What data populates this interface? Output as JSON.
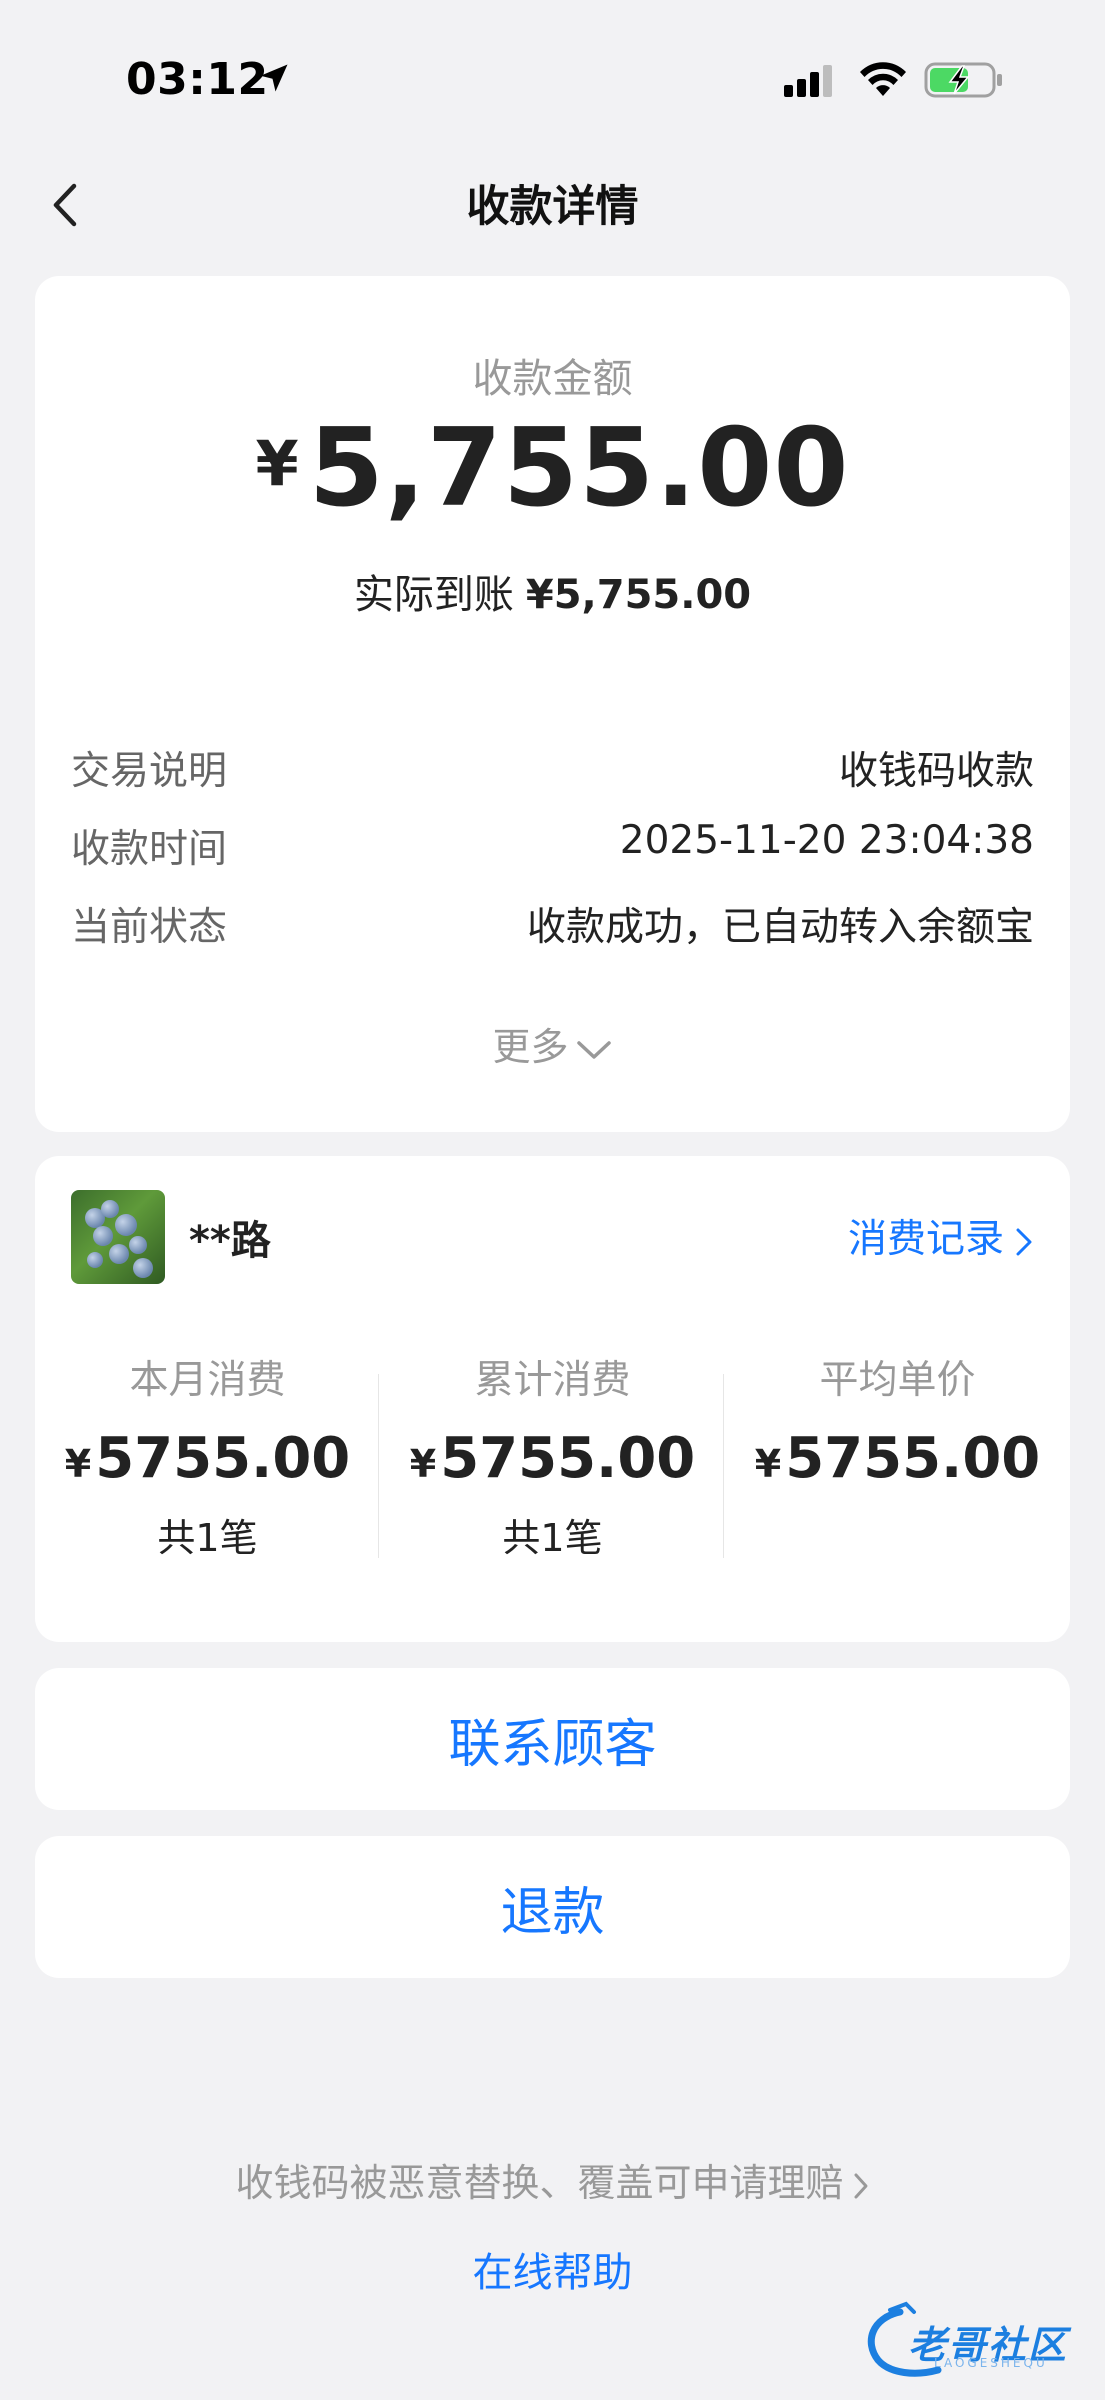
{
  "status_bar": {
    "time": "03:12"
  },
  "nav": {
    "title": "收款详情"
  },
  "summary": {
    "amount_label": "收款金额",
    "currency": "¥",
    "amount": "5,755.00",
    "actual_label": "实际到账",
    "actual_amount": "¥5,755.00",
    "details": [
      {
        "label": "交易说明",
        "value": "收钱码收款"
      },
      {
        "label": "收款时间",
        "value": "2025-11-20 23:04:38"
      },
      {
        "label": "当前状态",
        "value": "收款成功，已自动转入余额宝"
      }
    ],
    "more_label": "更多"
  },
  "customer": {
    "name": "**路",
    "records_link": "消费记录",
    "stats": [
      {
        "label": "本月消费",
        "currency": "¥",
        "value": "5755.00",
        "count": "共1笔"
      },
      {
        "label": "累计消费",
        "currency": "¥",
        "value": "5755.00",
        "count": "共1笔"
      },
      {
        "label": "平均单价",
        "currency": "¥",
        "value": "5755.00",
        "count": ""
      }
    ]
  },
  "actions": {
    "contact_label": "联系顾客",
    "refund_label": "退款"
  },
  "footer": {
    "claim_link": "收钱码被恶意替换、覆盖可申请理赔",
    "help_link": "在线帮助"
  },
  "watermark": {
    "text": "老哥社区",
    "sub": "LAOGESHEQU"
  },
  "colors": {
    "accent": "#1677ff",
    "background": "#f2f2f4",
    "card": "#ffffff",
    "muted": "#999999"
  },
  "icons": [
    "location-arrow-icon",
    "cellular-signal-icon",
    "wifi-icon",
    "battery-charging-icon",
    "back-chevron-icon",
    "chevron-down-icon",
    "chevron-right-icon"
  ]
}
